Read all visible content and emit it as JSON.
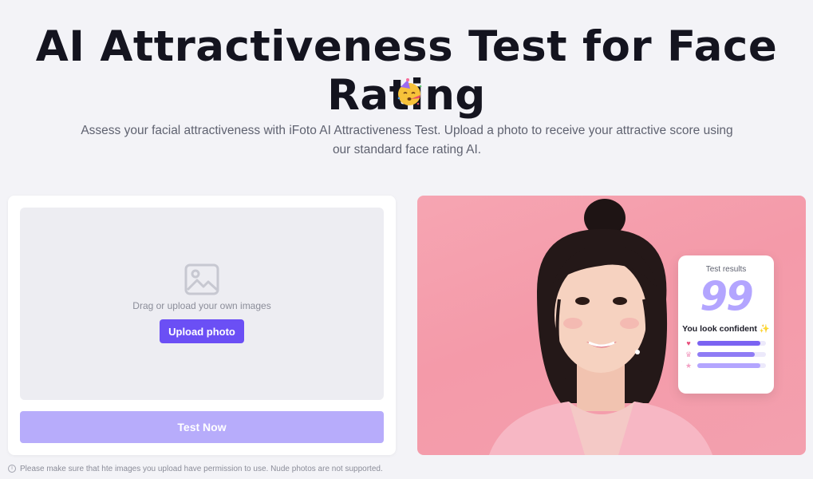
{
  "hero": {
    "title": "AI Attractiveness Test for Face Rating",
    "emoji": "partying-face-emoji",
    "subtitle": "Assess your facial attractiveness with iFoto AI Attractiveness Test. Upload a photo to receive your attractive score using our standard face rating AI."
  },
  "upload": {
    "drop_text": "Drag or upload your own images",
    "upload_button": "Upload photo",
    "test_button": "Test Now",
    "disclaimer": "Please make sure that hte images you upload have permission to use. Nude photos are not supported.",
    "icon": "image-icon"
  },
  "result_card": {
    "title": "Test results",
    "score": "99",
    "caption": "You look confident",
    "caption_icon": "sparkle-icon",
    "metrics": [
      {
        "icon": "heart-icon",
        "level": 0.92,
        "color": "#7b63f2"
      },
      {
        "icon": "crown-icon",
        "level": 0.84,
        "color": "#8f7cf5"
      },
      {
        "icon": "star-icon",
        "level": 0.92,
        "color": "#b3a5ff"
      }
    ]
  },
  "colors": {
    "accent": "#6b4ff5",
    "accent_disabled": "#b7acfb",
    "preview_background": "#f49aa9"
  }
}
